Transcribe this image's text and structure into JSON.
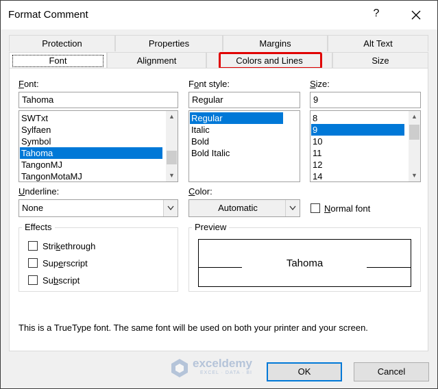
{
  "window": {
    "title": "Format Comment",
    "help_label": "?"
  },
  "tabs_back": [
    {
      "label": "Protection"
    },
    {
      "label": "Properties"
    },
    {
      "label": "Margins"
    },
    {
      "label": "Alt Text"
    }
  ],
  "tabs_front": [
    {
      "label": "Font"
    },
    {
      "label": "Alignment"
    },
    {
      "label": "Colors and Lines"
    },
    {
      "label": "Size"
    }
  ],
  "highlight_color": "#e00000",
  "font": {
    "label_prefix": "F",
    "label_rest": "ont:",
    "value": "Tahoma",
    "items": [
      "SWTxt",
      "Sylfaen",
      "Symbol",
      "Tahoma",
      "TangonMJ",
      "TangonMotaMJ"
    ],
    "selected": "Tahoma"
  },
  "font_style": {
    "label_a": "F",
    "label_u": "o",
    "label_b": "nt style:",
    "value": "Regular",
    "items": [
      "Regular",
      "Italic",
      "Bold",
      "Bold Italic"
    ],
    "selected": "Regular"
  },
  "size": {
    "label_u": "S",
    "label_rest": "ize:",
    "value": "9",
    "items": [
      "8",
      "9",
      "10",
      "11",
      "12",
      "14"
    ],
    "selected": "9"
  },
  "underline": {
    "label_u": "U",
    "label_rest": "nderline:",
    "value": "None"
  },
  "color": {
    "label_u": "C",
    "label_rest": "olor:",
    "value": "Automatic"
  },
  "normal_font": {
    "label_u": "N",
    "label_rest": "ormal font",
    "checked": false
  },
  "effects": {
    "title": "Effects",
    "strikethrough": {
      "a": "Stri",
      "u": "k",
      "b": "ethrough",
      "checked": false
    },
    "superscript": {
      "a": "Sup",
      "u": "e",
      "b": "rscript",
      "checked": false
    },
    "subscript": {
      "a": "Su",
      "u": "b",
      "b": "script",
      "checked": false
    }
  },
  "preview": {
    "title": "Preview",
    "sample_text": "Tahoma"
  },
  "info_text": "This is a TrueType font.  The same font will be used on both your printer and your screen.",
  "watermark": {
    "name": "exceldemy",
    "tagline": "EXCEL · DATA · BI"
  },
  "buttons": {
    "ok": "OK",
    "cancel": "Cancel"
  },
  "colors": {
    "selection": "#0078d7",
    "default_button_border": "#0078d7"
  }
}
